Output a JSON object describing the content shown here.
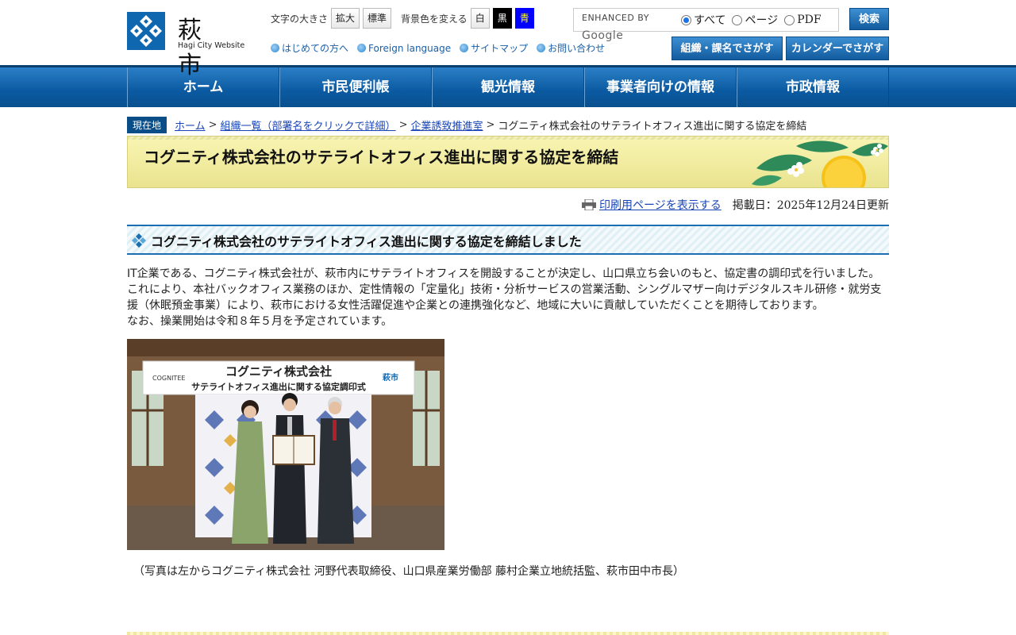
{
  "header": {
    "logo_jp": "萩 市",
    "logo_en": "Hagi City Website",
    "font_size_label": "文字の大きさ",
    "font_buttons": [
      "拡大",
      "標準"
    ],
    "bg_label": "背景色を変える",
    "bg_buttons": [
      "白",
      "黒",
      "青"
    ],
    "quick_links": [
      "はじめての方へ",
      "Foreign language",
      "サイトマップ",
      "お問い合わせ"
    ],
    "search": {
      "enhanced_by": "ENHANCED BY",
      "google": "Google",
      "options": [
        "すべて",
        "ページ",
        "PDF"
      ],
      "selected": "すべて",
      "button": "検索"
    },
    "org_button": "組織・課名でさがす",
    "calendar_button": "カレンダーでさがす"
  },
  "nav": [
    "ホーム",
    "市民便利帳",
    "観光情報",
    "事業者向けの情報",
    "市政情報"
  ],
  "breadcrumb": {
    "here_label": "現在地",
    "links": [
      "ホーム",
      "組織一覧（部署名をクリックで詳細）",
      "企業誘致推進室"
    ],
    "current": "コグニティ株式会社のサテライトオフィス進出に関する協定を締結"
  },
  "page_title": "コグニティ株式会社のサテライトオフィス進出に関する協定を締結",
  "print_link": "印刷用ページを表示する",
  "updated": "掲載日：2025年12月24日更新",
  "section_heading": "コグニティ株式会社のサテライトオフィス進出に関する協定を締結しました",
  "paragraphs": [
    "IT企業である、コグニティ株式会社が、萩市内にサテライトオフィスを開設することが決定し、山口県立ち会いのもと、協定書の調印式を行いました。",
    "これにより、本社バックオフィス業務のほか、定性情報の「定量化」技術・分析サービスの営業活動、シングルマザー向けデジタルスキル研修・就労支援（休眠預金事業）により、萩市における女性活躍促進や企業との連携強化など、地域に大いに貢献していただくことを期待しております。",
    "なお、操業開始は令和８年５月を予定されています。"
  ],
  "photo": {
    "banner_line1": "コグニティ株式会社",
    "banner_line2": "サテライトオフィス進出に関する協定調印式",
    "banner_left_logo": "COGNITEE",
    "banner_right_logo": "萩市"
  },
  "caption": "（写真は左からコグニティ株式会社 河野代表取締役、山口県産業労働部 藤村企業立地統括監、萩市田中市長）"
}
